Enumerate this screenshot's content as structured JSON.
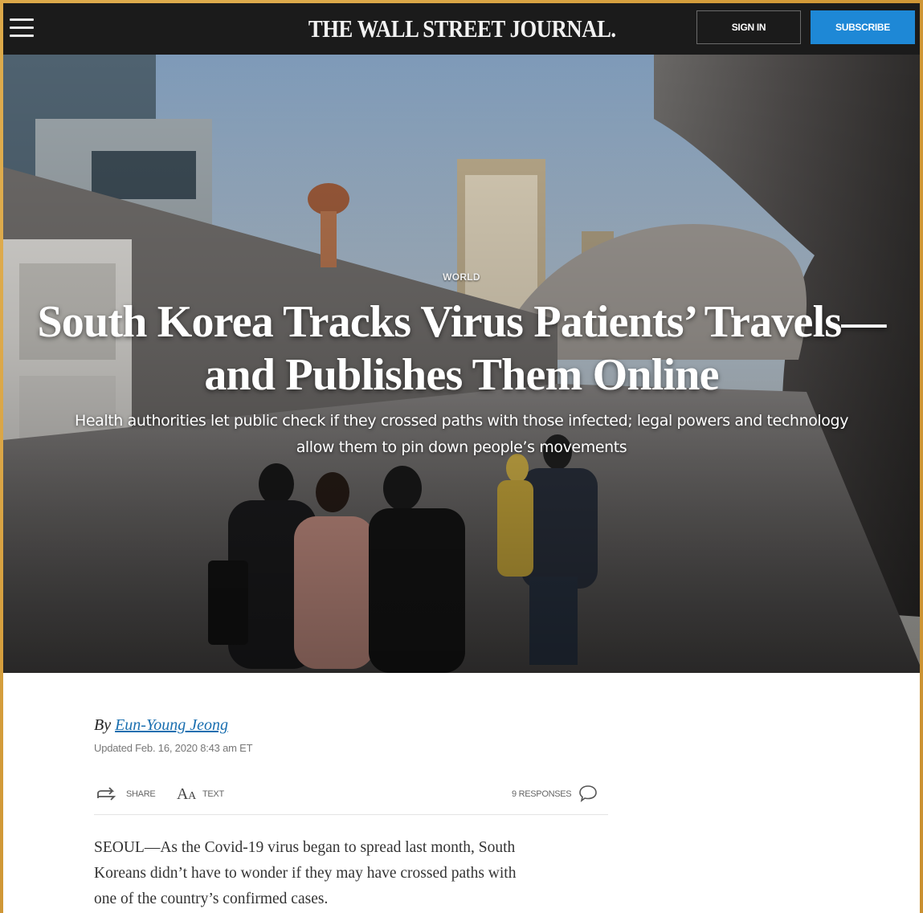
{
  "header": {
    "masthead": "THE WALL STREET JOURNAL.",
    "sign_in_label": "SIGN IN",
    "subscribe_label": "SUBSCRIBE",
    "subscribe_color": "#1e88d6"
  },
  "hero": {
    "section": "WORLD",
    "headline_line1": "South Korea Tracks Virus Patients’ Travels—",
    "headline_line2": "and Publishes Them Online",
    "dek_line1": "Health authorities let public check if they crossed paths with those infected; legal powers and technology",
    "dek_line2": "allow them to pin down people’s movements"
  },
  "article": {
    "byline_prefix": "By",
    "author": "Eun-Young Jeong",
    "timestamp": "Updated Feb. 16, 2020 8:43 am ET",
    "toolbar": {
      "share_label": "SHARE",
      "text_label": "TEXT",
      "text_icon": "Aa",
      "responses_label": "9 RESPONSES"
    },
    "paragraph_line1": "SEOUL—As the Covid-19 virus began to spread last month, South",
    "paragraph_line2": "Koreans didn’t have to wonder if they may have crossed paths with",
    "paragraph_line3": "one of the country’s confirmed cases."
  },
  "icons": {
    "menu": "hamburger-menu-icon",
    "share": "share-arrow-icon",
    "text": "text-size-icon",
    "responses": "speech-bubble-icon"
  }
}
